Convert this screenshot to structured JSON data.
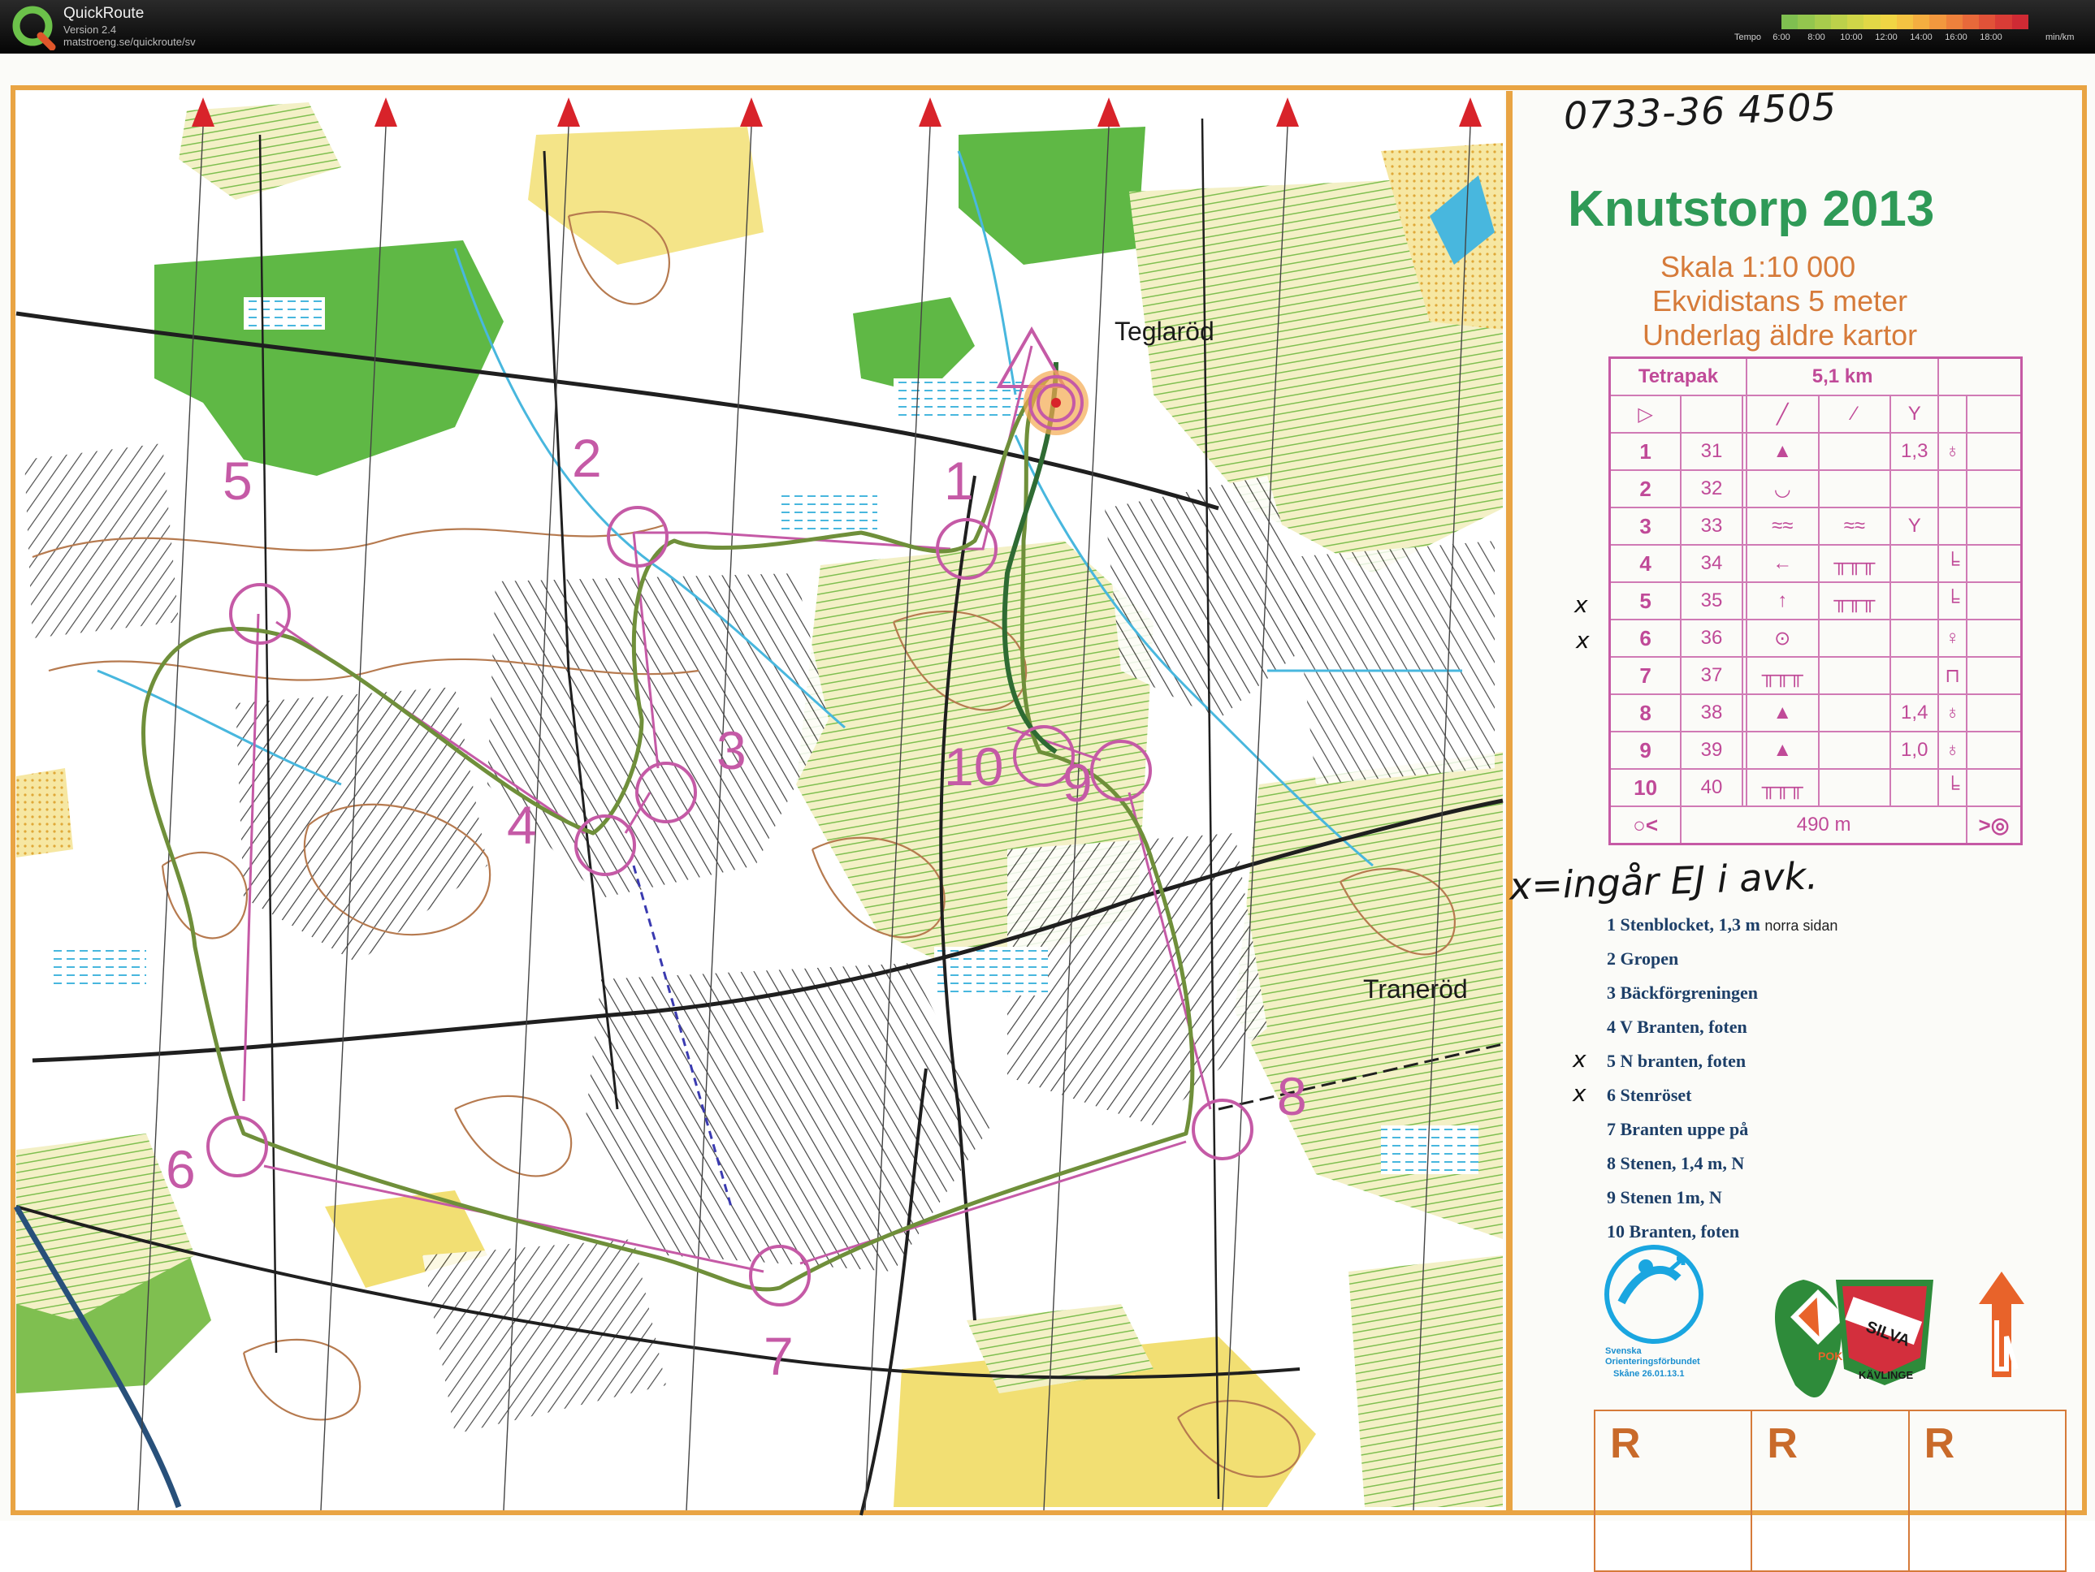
{
  "header": {
    "app_name": "QuickRoute",
    "version": "Version 2.4",
    "url": "matstroeng.se/quickroute/sv",
    "tempo_label": "Tempo",
    "tempo_ticks": [
      "6:00",
      "8:00",
      "10:00",
      "12:00",
      "14:00",
      "16:00",
      "18:00"
    ],
    "tempo_unit": "min/km",
    "tempo_colors": [
      "#7fbf50",
      "#93c64e",
      "#a8cc4c",
      "#bcd14a",
      "#cfd548",
      "#e1d846",
      "#f0d544",
      "#f4c342",
      "#f4ae40",
      "#f2983e",
      "#ee813c",
      "#e8693a",
      "#e15238",
      "#d93c36",
      "#cf2a34"
    ]
  },
  "map": {
    "phone_note": "0733-36 4505",
    "title": "Knutstorp 2013",
    "scale": "Skala 1:10 000",
    "contour": "Ekvidistans 5 meter",
    "base": "Underlag äldre kartor",
    "place_teglarod": "Teglaröd",
    "place_tranerod": "Traneröd",
    "handnote": "x=ingår EJ i avk.",
    "control_numbers": [
      "1",
      "2",
      "3",
      "4",
      "5",
      "6",
      "7",
      "8",
      "9",
      "10"
    ]
  },
  "course": {
    "name": "Tetrapak",
    "length": "5,1 km",
    "finish_distance": "490 m",
    "rows": [
      {
        "n": "1",
        "code": "31",
        "b": "▲",
        "c": "",
        "d": "1,3",
        "e": "♁"
      },
      {
        "n": "2",
        "code": "32",
        "b": "◡",
        "c": "",
        "d": "",
        "e": ""
      },
      {
        "n": "3",
        "code": "33",
        "b": "≈≈",
        "c": "≈≈",
        "d": "Y",
        "e": ""
      },
      {
        "n": "4",
        "code": "34",
        "b": "←",
        "c": "╥╥╥",
        "d": "",
        "e": "╘"
      },
      {
        "n": "5",
        "code": "35",
        "b": "↑",
        "c": "╥╥╥",
        "d": "",
        "e": "╘"
      },
      {
        "n": "6",
        "code": "36",
        "b": "⊙",
        "c": "",
        "d": "",
        "e": "♀"
      },
      {
        "n": "7",
        "code": "37",
        "b": "╥╥╥",
        "c": "",
        "d": "",
        "e": "⊓"
      },
      {
        "n": "8",
        "code": "38",
        "b": "▲",
        "c": "",
        "d": "1,4",
        "e": "♁"
      },
      {
        "n": "9",
        "code": "39",
        "b": "▲",
        "c": "",
        "d": "1,0",
        "e": "♁"
      },
      {
        "n": "10",
        "code": "40",
        "b": "╥╥╥",
        "c": "",
        "d": "",
        "e": "╘"
      }
    ]
  },
  "descriptions": [
    {
      "text": "1 Stenblocket, 1,3 m",
      "note": "norra sidan"
    },
    {
      "text": "2 Gropen",
      "note": ""
    },
    {
      "text": "3 Bäckförgreningen",
      "note": ""
    },
    {
      "text": "4 V Branten, foten",
      "note": ""
    },
    {
      "text": "5 N branten, foten",
      "note": ""
    },
    {
      "text": "6 Stenröset",
      "note": ""
    },
    {
      "text": "7 Branten uppe på",
      "note": ""
    },
    {
      "text": "8 Stenen, 1,4 m, N",
      "note": ""
    },
    {
      "text": "9 Stenen 1m, N",
      "note": ""
    },
    {
      "text": "10 Branten, foten",
      "note": ""
    }
  ],
  "logos": {
    "sof_text": "Svenska Orienteringsförbundet",
    "sof_date": "Skåne 26.01.13.1",
    "club1": "POK",
    "club2": "SILVA",
    "club2_sub": "KÄVLINGE"
  },
  "r_labels": [
    "R",
    "R",
    "R"
  ],
  "colors": {
    "control": "#c55aa6",
    "route": "#6f8f3a",
    "forest_green": "#5fb845",
    "yellow": "#f2df73",
    "contour": "#b67a4f",
    "water": "#48b7de"
  }
}
